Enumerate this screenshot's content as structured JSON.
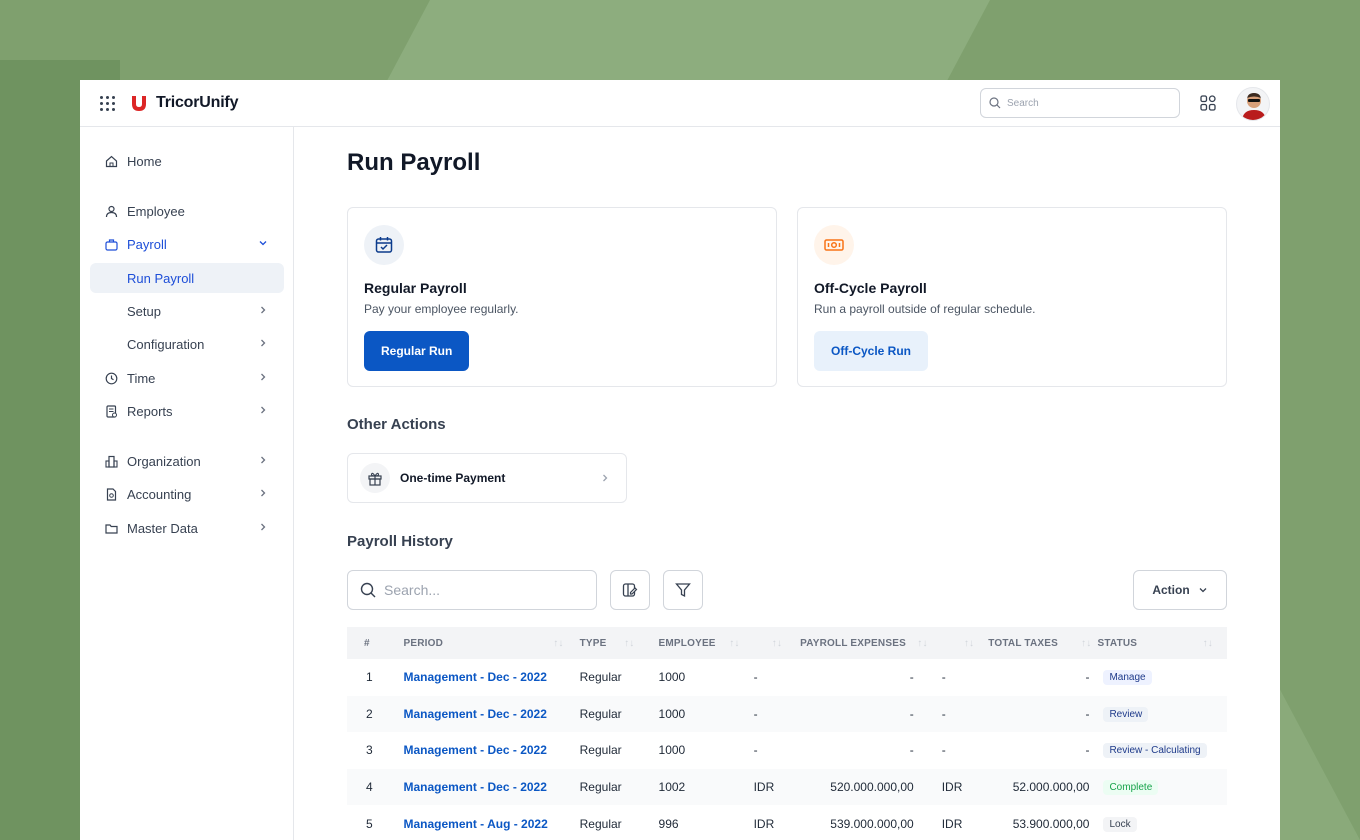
{
  "header": {
    "brand": "TricorUnify",
    "search_placeholder": "Search"
  },
  "sidebar": {
    "items": [
      {
        "label": "Home",
        "icon": "home-icon"
      },
      {
        "label": "Employee",
        "icon": "user-icon"
      },
      {
        "label": "Payroll",
        "icon": "briefcase-icon"
      },
      {
        "label": "Run Payroll"
      },
      {
        "label": "Setup"
      },
      {
        "label": "Configuration"
      },
      {
        "label": "Time",
        "icon": "clock-icon"
      },
      {
        "label": "Reports",
        "icon": "report-icon"
      },
      {
        "label": "Organization",
        "icon": "building-icon"
      },
      {
        "label": "Accounting",
        "icon": "document-icon"
      },
      {
        "label": "Master Data",
        "icon": "folder-icon"
      }
    ]
  },
  "main": {
    "title": "Run Payroll",
    "regular": {
      "title": "Regular Payroll",
      "desc": "Pay your employee regularly.",
      "button": "Regular Run"
    },
    "offcycle": {
      "title": "Off-Cycle Payroll",
      "desc": "Run a payroll outside of regular schedule.",
      "button": "Off-Cycle Run"
    },
    "other_actions": {
      "title": "Other Actions",
      "one_time": "One-time Payment"
    },
    "history": {
      "title": "Payroll History",
      "search_placeholder": "Search...",
      "action_label": "Action",
      "columns": [
        "#",
        "PERIOD",
        "TYPE",
        "EMPLOYEE",
        "PAYROLL EXPENSES",
        "TOTAL TAXES",
        "STATUS"
      ],
      "rows": [
        {
          "n": "1",
          "period": "Management - Dec - 2022",
          "type": "Regular",
          "employee": "1000",
          "exp_cur": "-",
          "exp": "-",
          "tax_cur": "-",
          "tax": "-",
          "status": "Manage"
        },
        {
          "n": "2",
          "period": "Management - Dec - 2022",
          "type": "Regular",
          "employee": "1000",
          "exp_cur": "-",
          "exp": "-",
          "tax_cur": "-",
          "tax": "-",
          "status": "Review"
        },
        {
          "n": "3",
          "period": "Management - Dec - 2022",
          "type": "Regular",
          "employee": "1000",
          "exp_cur": "-",
          "exp": "-",
          "tax_cur": "-",
          "tax": "-",
          "status": "Review - Calculating"
        },
        {
          "n": "4",
          "period": "Management - Dec - 2022",
          "type": "Regular",
          "employee": "1002",
          "exp_cur": "IDR",
          "exp": "520.000.000,00",
          "tax_cur": "IDR",
          "tax": "52.000.000,00",
          "status": "Complete"
        },
        {
          "n": "5",
          "period": "Management - Aug - 2022",
          "type": "Regular",
          "employee": "996",
          "exp_cur": "IDR",
          "exp": "539.000.000,00",
          "tax_cur": "IDR",
          "tax": "53.900.000,00",
          "status": "Lock"
        }
      ]
    }
  },
  "colors": {
    "primary": "#0b57c4",
    "background": "#7fa06e",
    "offcycle_accent": "#f97316"
  }
}
